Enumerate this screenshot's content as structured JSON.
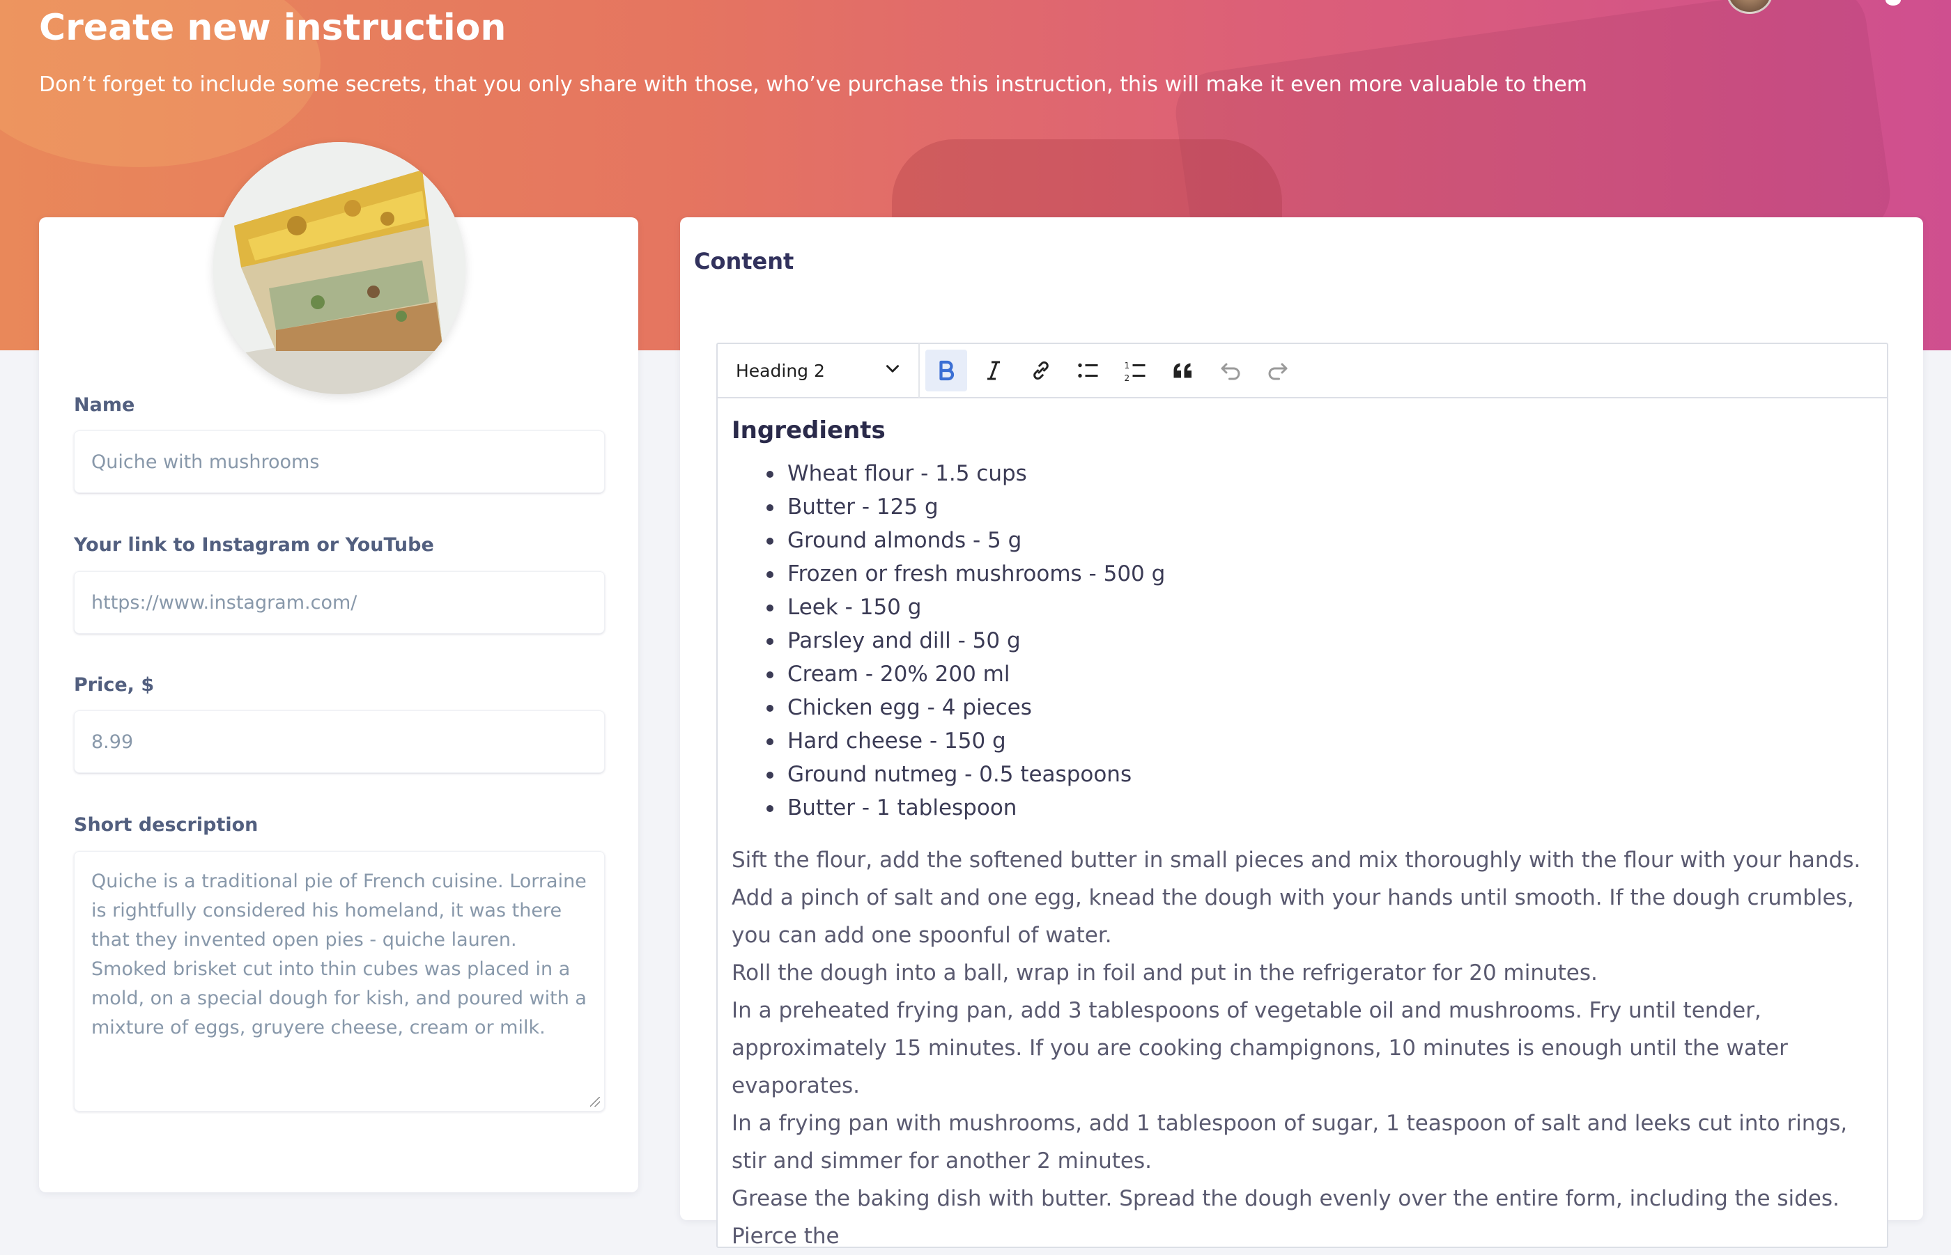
{
  "header": {
    "title": "Create new instruction",
    "subtitle": "Don’t forget to include some secrets, that you only share with those, who’ve purchase this instruction, this will make it even more valuable to them"
  },
  "form": {
    "name_label": "Name",
    "name_value": "Quiche with mushrooms",
    "link_label": "Your link to Instagram or YouTube",
    "link_value": "https://www.instagram.com/",
    "price_label": "Price, $",
    "price_value": "8.99",
    "description_label": "Short description",
    "description_value": "Quiche is a traditional pie of French cuisine. Lorraine is rightfully considered his homeland, it was there that they invented open pies - quiche lauren. Smoked brisket cut into thin cubes was placed in a mold, on a special dough for kish, and poured with a mixture of eggs, gruyere cheese, cream or milk."
  },
  "content": {
    "title": "Content",
    "toolbar": {
      "heading_select": "Heading 2",
      "buttons": [
        "bold-icon",
        "italic-icon",
        "link-icon",
        "bulleted-list-icon",
        "numbered-list-icon",
        "quote-icon",
        "undo-icon",
        "redo-icon"
      ]
    },
    "heading": "Ingredients",
    "ingredients": [
      "Wheat flour - 1.5 cups",
      "Butter - 125 g",
      "Ground almonds - 5 g",
      "Frozen or fresh mushrooms - 500 g",
      "Leek - 150 g",
      "Parsley and dill - 50 g",
      "Cream - 20% 200 ml",
      "Chicken egg - 4 pieces",
      "Hard cheese - 150 g",
      "Ground nutmeg - 0.5 teaspoons",
      "Butter - 1 tablespoon"
    ],
    "paragraphs": [
      "Sift the flour, add the softened butter in small pieces and mix thoroughly with the flour with your hands. Add a pinch of salt and one egg, knead the dough with your hands until smooth. If the dough crumbles, you can add one spoonful of water.",
      "Roll the dough into a ball, wrap in foil and put in the refrigerator for 20 minutes.",
      "In a preheated frying pan, add 3 tablespoons of vegetable oil and mushrooms. Fry until tender, approximately 15 minutes. If you are cooking champignons, 10 minutes is enough until the water evaporates.",
      "In a frying pan with mushrooms, add 1 tablespoon of sugar, 1 teaspoon of salt and leeks cut into rings, stir and simmer for another 2 minutes.",
      "Grease the baking dish with butter. Spread the dough evenly over the entire form, including the sides. Pierce the"
    ]
  }
}
